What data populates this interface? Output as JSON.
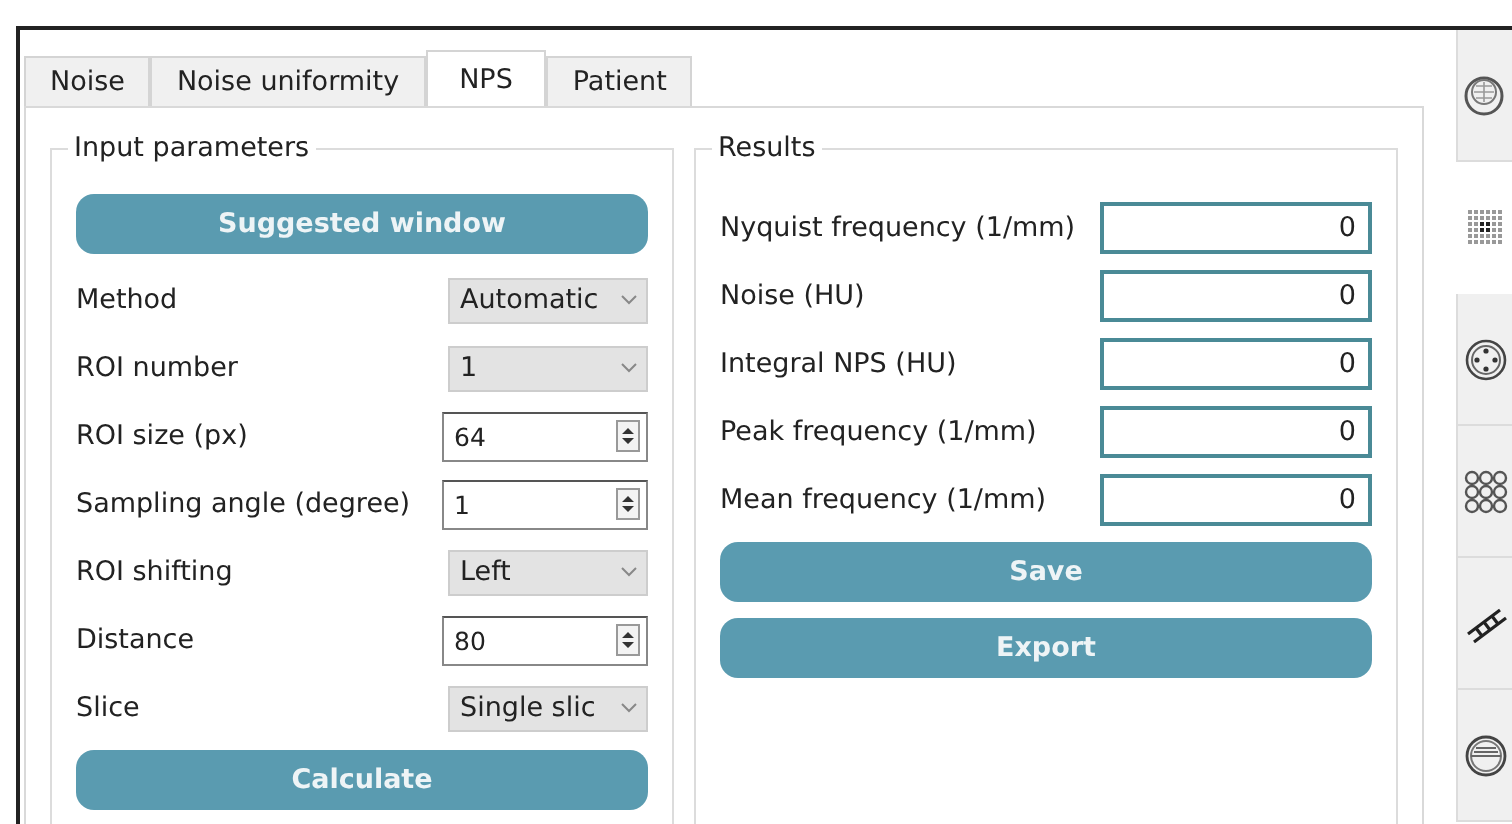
{
  "tabs": [
    {
      "label": "Noise",
      "selected": false
    },
    {
      "label": "Noise uniformity",
      "selected": false
    },
    {
      "label": "NPS",
      "selected": true
    },
    {
      "label": "Patient",
      "selected": false
    }
  ],
  "input_parameters": {
    "title": "Input parameters",
    "suggested_button": "Suggested window",
    "fields": [
      {
        "label": "Method",
        "kind": "dropdown",
        "value": "Automatic"
      },
      {
        "label": "ROI number",
        "kind": "dropdown",
        "value": "1"
      },
      {
        "label": "ROI size (px)",
        "kind": "spinbox",
        "value": "64"
      },
      {
        "label": "Sampling angle (degree)",
        "kind": "spinbox",
        "value": "1"
      },
      {
        "label": "ROI shifting",
        "kind": "dropdown",
        "value": "Left"
      },
      {
        "label": "Distance",
        "kind": "spinbox",
        "value": "80"
      },
      {
        "label": "Slice",
        "kind": "dropdown",
        "value": "Single slic"
      }
    ],
    "calculate_button": "Calculate"
  },
  "results": {
    "title": "Results",
    "fields": [
      {
        "label": "Nyquist frequency (1/mm)",
        "value": "0"
      },
      {
        "label": "Noise (HU)",
        "value": "0"
      },
      {
        "label": "Integral NPS (HU)",
        "value": "0"
      },
      {
        "label": "Peak frequency (1/mm)",
        "value": "0"
      },
      {
        "label": "Mean frequency (1/mm)",
        "value": "0"
      }
    ],
    "buttons": [
      "Save",
      "Export"
    ]
  },
  "side_tabs": [
    {
      "selected": false
    },
    {
      "selected": true
    },
    {
      "selected": false
    },
    {
      "selected": false
    },
    {
      "selected": false
    },
    {
      "selected": false
    }
  ]
}
